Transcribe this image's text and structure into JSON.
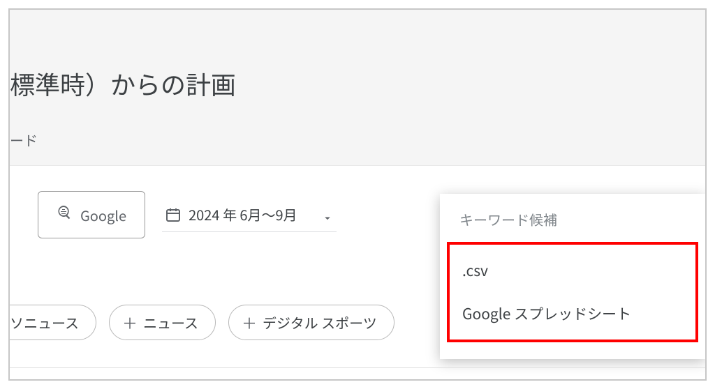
{
  "header": {
    "title_fragment": "標準時）からの計画",
    "subtitle_fragment": "ード"
  },
  "controls": {
    "google_button_label": "Google",
    "date_range_label": "2024 年 6月～9月"
  },
  "chips": {
    "partial_label": "ソニュース",
    "chip_news_label": "ニュース",
    "chip_digital_sports_label": "デジタル スポーツ"
  },
  "dropdown": {
    "header": "キーワード候補",
    "item_csv": ".csv",
    "item_google_sheets": "Google スプレッドシート"
  }
}
